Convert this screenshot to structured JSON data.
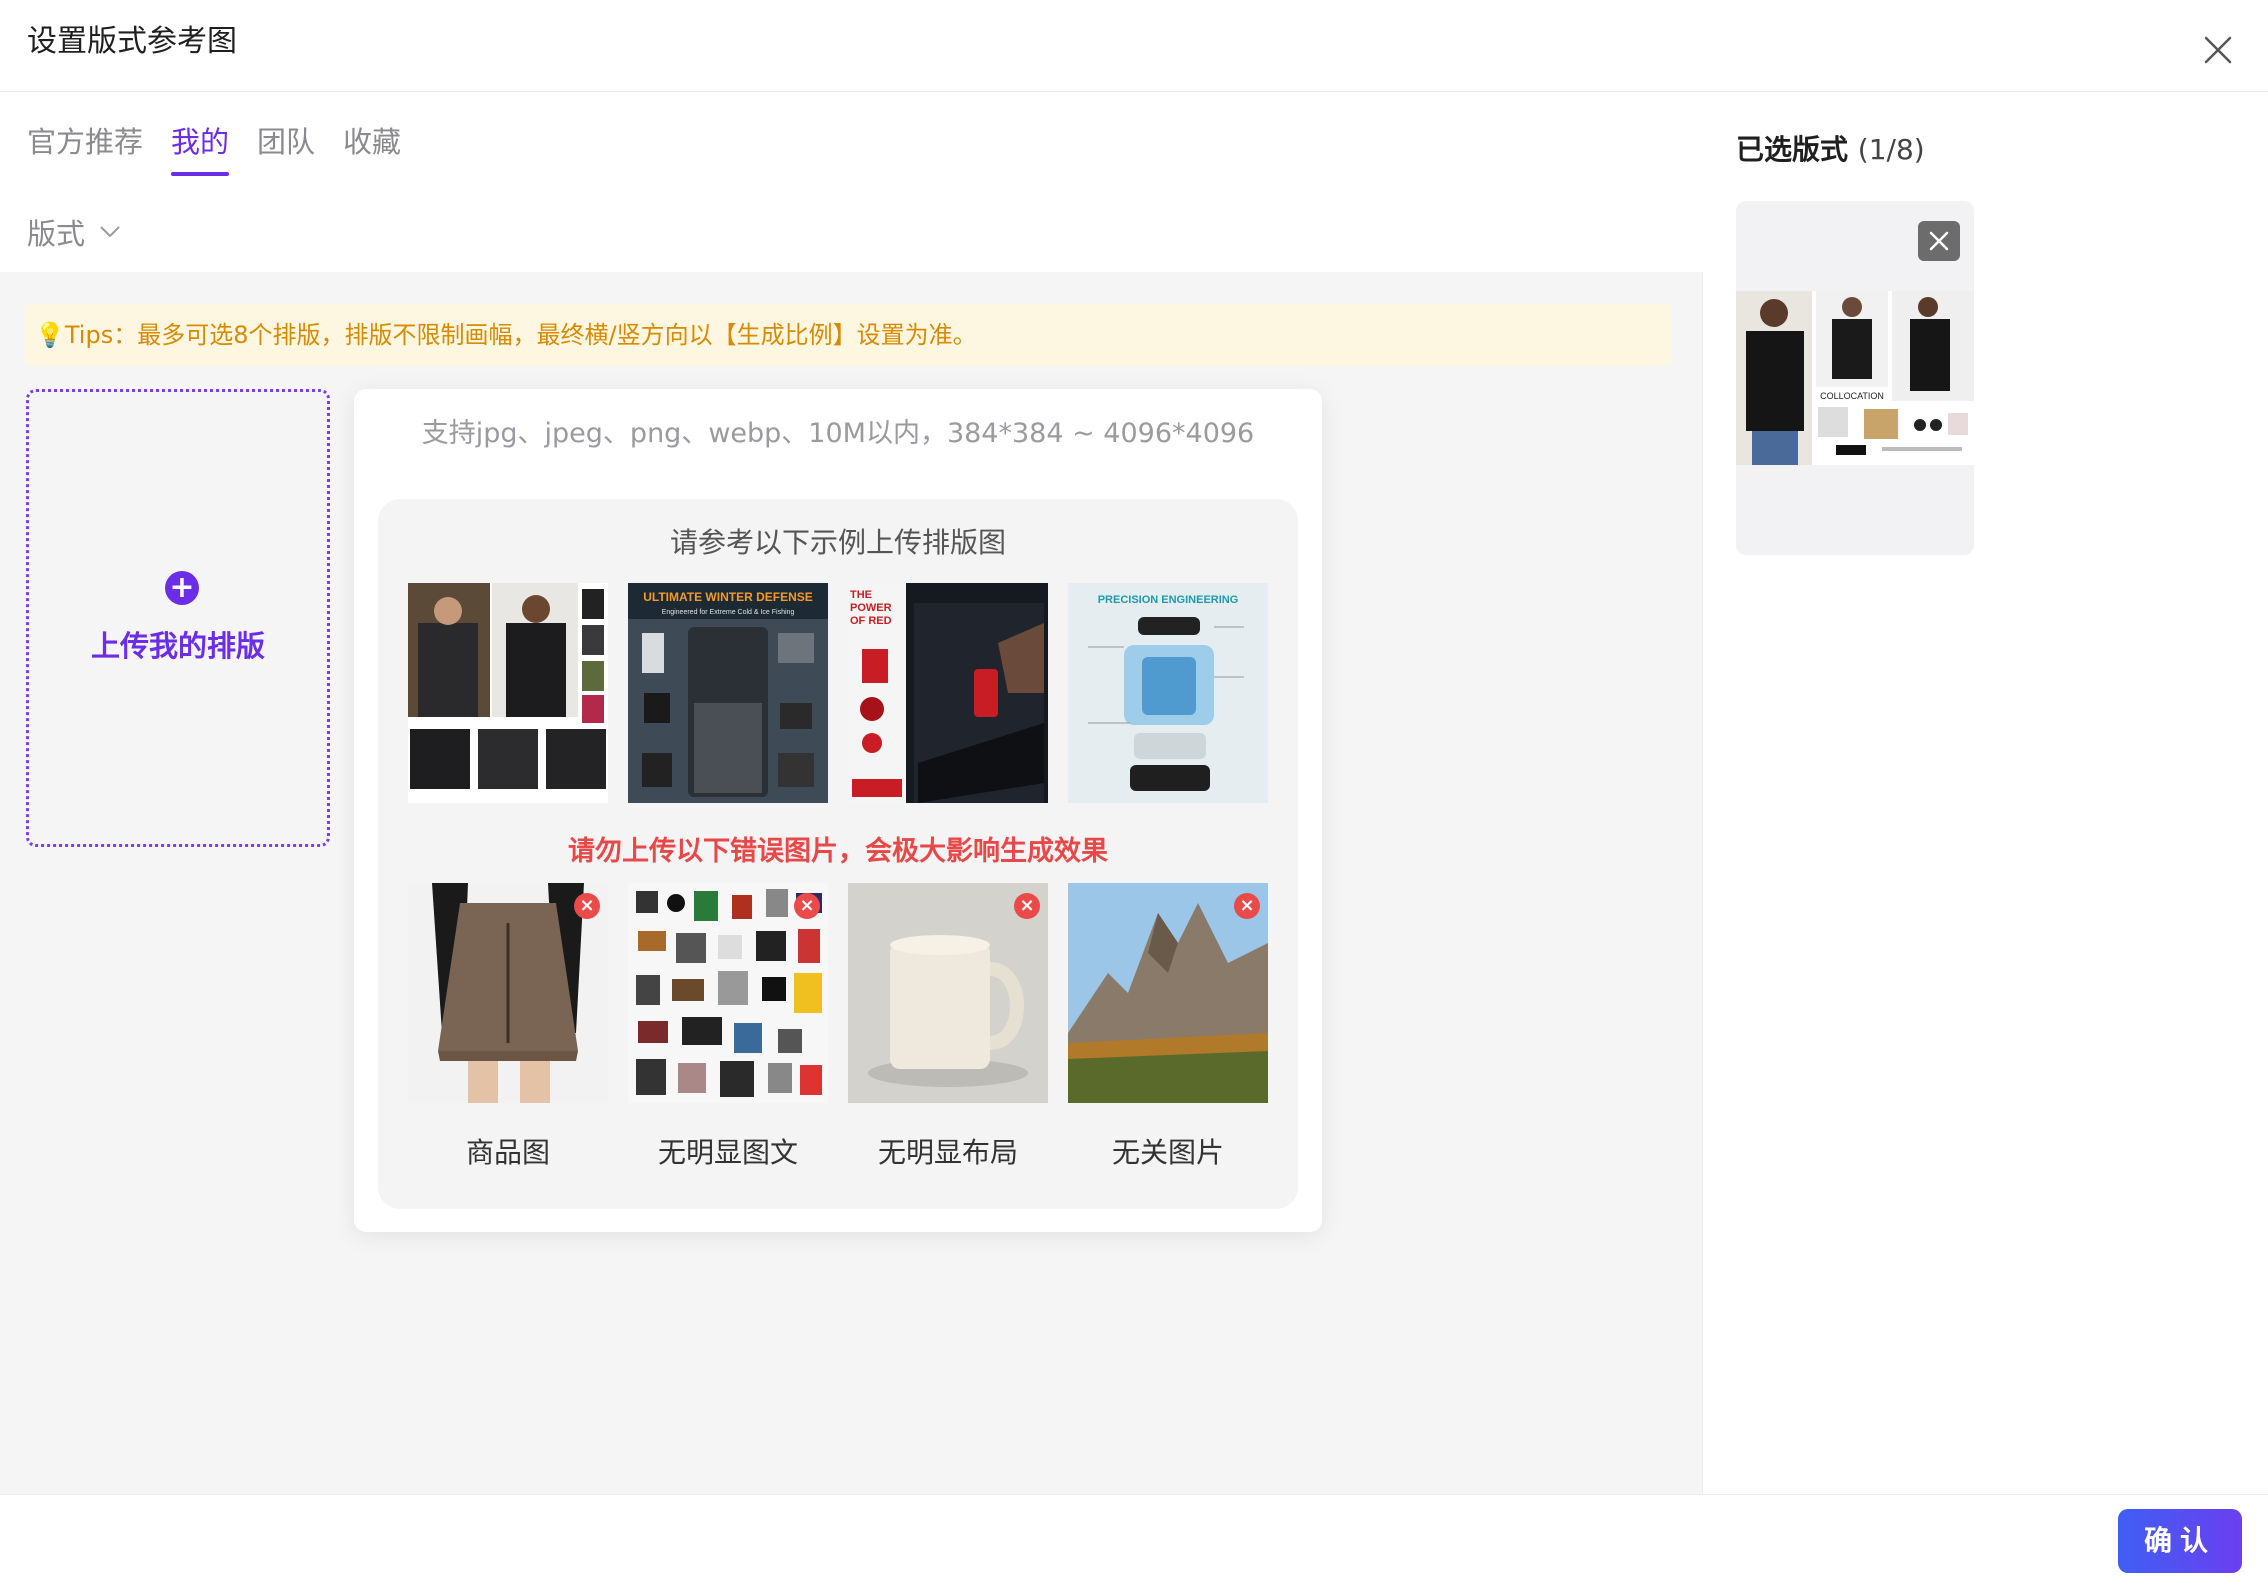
{
  "dialog": {
    "title": "设置版式参考图"
  },
  "tabs": [
    {
      "label": "官方推荐",
      "active": false
    },
    {
      "label": "我的",
      "active": true
    },
    {
      "label": "团队",
      "active": false
    },
    {
      "label": "收藏",
      "active": false
    }
  ],
  "filter": {
    "label": "版式"
  },
  "tips": {
    "text": "💡Tips：最多可选8个排版，排版不限制画幅，最终横/竖方向以【生成比例】设置为准。"
  },
  "upload": {
    "label": "上传我的排版"
  },
  "popover": {
    "support_text": "支持jpg、jpeg、png、webp、10M以内，384*384 ~ 4096*4096",
    "good_title": "请参考以下示例上传排版图",
    "good_examples": [
      {
        "icon": "jacket-collage-image"
      },
      {
        "icon": "winter-gear-layout-image",
        "headline": "ULTIMATE WINTER DEFENSE",
        "subline": "Engineered for Extreme Cold & Ice Fishing"
      },
      {
        "icon": "red-tumbler-layout-image",
        "headline": "THE POWER OF RED"
      },
      {
        "icon": "humidifier-exploded-image",
        "headline": "PRECISION ENGINEERING"
      }
    ],
    "bad_title": "请勿上传以下错误图片，会极大影响生成效果",
    "bad_examples": [
      {
        "label": "商品图",
        "icon": "skirt-product-image"
      },
      {
        "label": "无明显图文",
        "icon": "scattered-collage-image"
      },
      {
        "label": "无明显布局",
        "icon": "mug-image"
      },
      {
        "label": "无关图片",
        "icon": "mountain-landscape-image"
      }
    ]
  },
  "selected": {
    "title": "已选版式",
    "count": "(1/8)",
    "item_caption": "COLLOCATION"
  },
  "footer": {
    "confirm_label": "确认"
  },
  "colors": {
    "accent": "#6b2de8",
    "warning": "#e84848",
    "tip": "#d88a00",
    "confirm_start": "#3f5ff2",
    "confirm_end": "#6b3ff0"
  }
}
